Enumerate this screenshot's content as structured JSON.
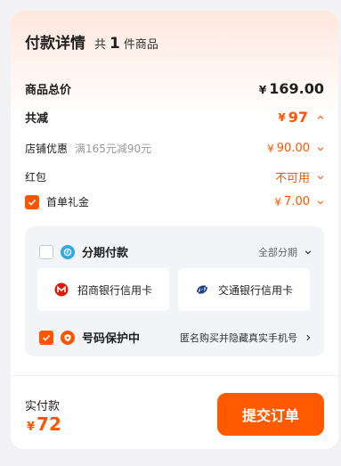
{
  "header": {
    "title": "付款详情",
    "count_prefix": "共",
    "count": "1",
    "count_suffix": "件商品"
  },
  "summary": {
    "total_label": "商品总价",
    "total_currency": "¥",
    "total_value": "169.00",
    "discount_label": "共减",
    "discount_currency": "¥",
    "discount_value": "97"
  },
  "discounts": {
    "shop": {
      "label": "店铺优惠",
      "note": "满165元减90元",
      "currency": "¥",
      "value": "90.00"
    },
    "red_packet": {
      "label": "红包",
      "value": "不可用"
    },
    "first_order": {
      "label": "首单礼金",
      "currency": "¥",
      "value": "7.00",
      "checked": true
    }
  },
  "installment": {
    "label": "分期付款",
    "checked": false,
    "option_label": "全部分期",
    "banks": [
      {
        "name": "招商银行信用卡",
        "icon": "cmb-bank-icon"
      },
      {
        "name": "交通银行信用卡",
        "icon": "bocom-bank-icon"
      }
    ]
  },
  "privacy": {
    "label": "号码保护中",
    "checked": true,
    "detail": "匿名购买并隐藏真实手机号"
  },
  "footer": {
    "pay_label": "实付款",
    "pay_currency": "¥",
    "pay_value": "72",
    "submit_label": "提交订单"
  },
  "colors": {
    "accent": "#ff5500",
    "panel_bg": "#f2f4f7",
    "page_bg": "#f2f2f4"
  }
}
